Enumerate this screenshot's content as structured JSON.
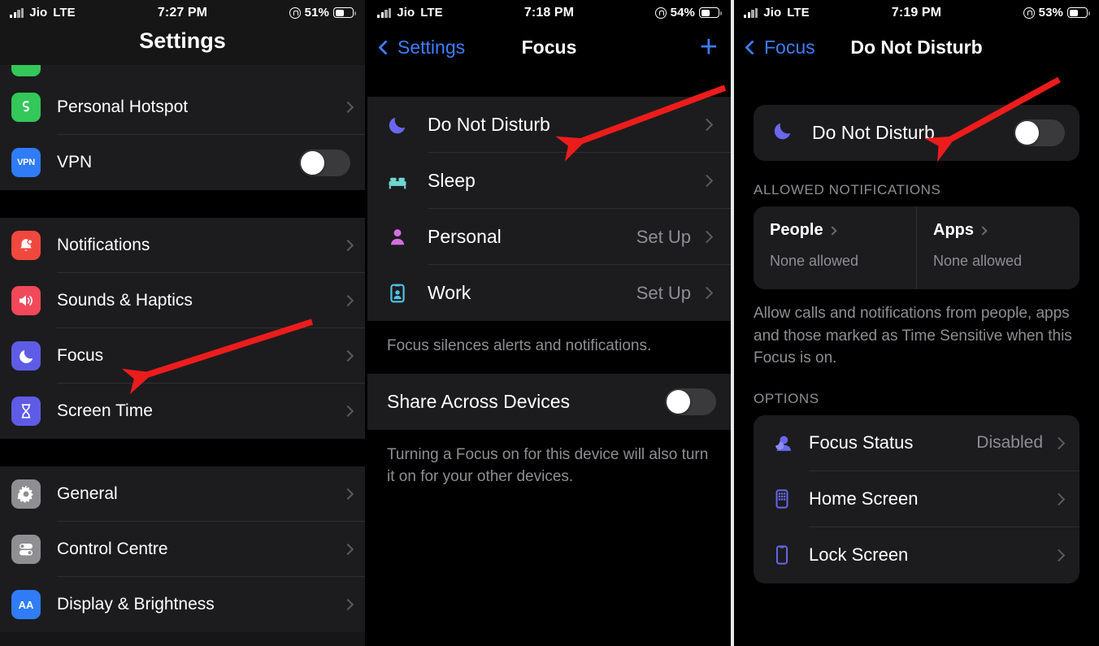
{
  "panels": [
    {
      "status": {
        "carrier": "Jio",
        "network": "LTE",
        "time": "7:27 PM",
        "battery": "51%"
      },
      "title": "Settings",
      "groups": [
        {
          "rows": [
            {
              "label": "Personal Hotspot",
              "icon": "hotspot-icon",
              "accessory": "chevron"
            },
            {
              "label": "VPN",
              "icon": "vpn-icon",
              "accessory": "toggle",
              "toggle_on": false
            }
          ]
        },
        {
          "rows": [
            {
              "label": "Notifications",
              "icon": "notifications-icon",
              "accessory": "chevron"
            },
            {
              "label": "Sounds & Haptics",
              "icon": "sounds-icon",
              "accessory": "chevron"
            },
            {
              "label": "Focus",
              "icon": "focus-moon-icon",
              "accessory": "chevron"
            },
            {
              "label": "Screen Time",
              "icon": "screen-time-icon",
              "accessory": "chevron"
            }
          ]
        },
        {
          "rows": [
            {
              "label": "General",
              "icon": "general-gear-icon",
              "accessory": "chevron"
            },
            {
              "label": "Control Centre",
              "icon": "control-centre-icon",
              "accessory": "chevron"
            },
            {
              "label": "Display & Brightness",
              "icon": "display-brightness-icon",
              "accessory": "chevron"
            }
          ]
        }
      ]
    },
    {
      "status": {
        "carrier": "Jio",
        "network": "LTE",
        "time": "7:18 PM",
        "battery": "54%"
      },
      "nav": {
        "back_label": "Settings",
        "title": "Focus",
        "add_label": "+"
      },
      "focus_rows": [
        {
          "label": "Do Not Disturb",
          "icon": "moon-icon",
          "value": ""
        },
        {
          "label": "Sleep",
          "icon": "bed-icon",
          "value": ""
        },
        {
          "label": "Personal",
          "icon": "person-icon",
          "value": "Set Up"
        },
        {
          "label": "Work",
          "icon": "work-badge-icon",
          "value": "Set Up"
        }
      ],
      "footnote1": "Focus silences alerts and notifications.",
      "share_row": {
        "label": "Share Across Devices",
        "toggle_on": false
      },
      "footnote2": "Turning a Focus on for this device will also turn it on for your other devices."
    },
    {
      "status": {
        "carrier": "Jio",
        "network": "LTE",
        "time": "7:19 PM",
        "battery": "53%"
      },
      "nav": {
        "back_label": "Focus",
        "title": "Do Not Disturb"
      },
      "dnd": {
        "label": "Do Not Disturb",
        "icon": "moon-icon",
        "toggle_on": false
      },
      "allowed_header": "ALLOWED NOTIFICATIONS",
      "allowed": [
        {
          "title": "People",
          "sub": "None allowed"
        },
        {
          "title": "Apps",
          "sub": "None allowed"
        }
      ],
      "allowed_desc": "Allow calls and notifications from people, apps and those marked as Time Sensitive when this Focus is on.",
      "options_header": "OPTIONS",
      "options": [
        {
          "label": "Focus Status",
          "value": "Disabled",
          "icon": "focus-status-icon"
        },
        {
          "label": "Home Screen",
          "value": "",
          "icon": "home-screen-icon"
        },
        {
          "label": "Lock Screen",
          "value": "",
          "icon": "lock-screen-icon"
        }
      ]
    }
  ],
  "annotations": {
    "arrow_color": "#ed1c1c",
    "arrows": [
      {
        "name": "arrow-to-focus"
      },
      {
        "name": "arrow-to-do-not-disturb"
      },
      {
        "name": "arrow-to-dnd-toggle"
      }
    ]
  }
}
